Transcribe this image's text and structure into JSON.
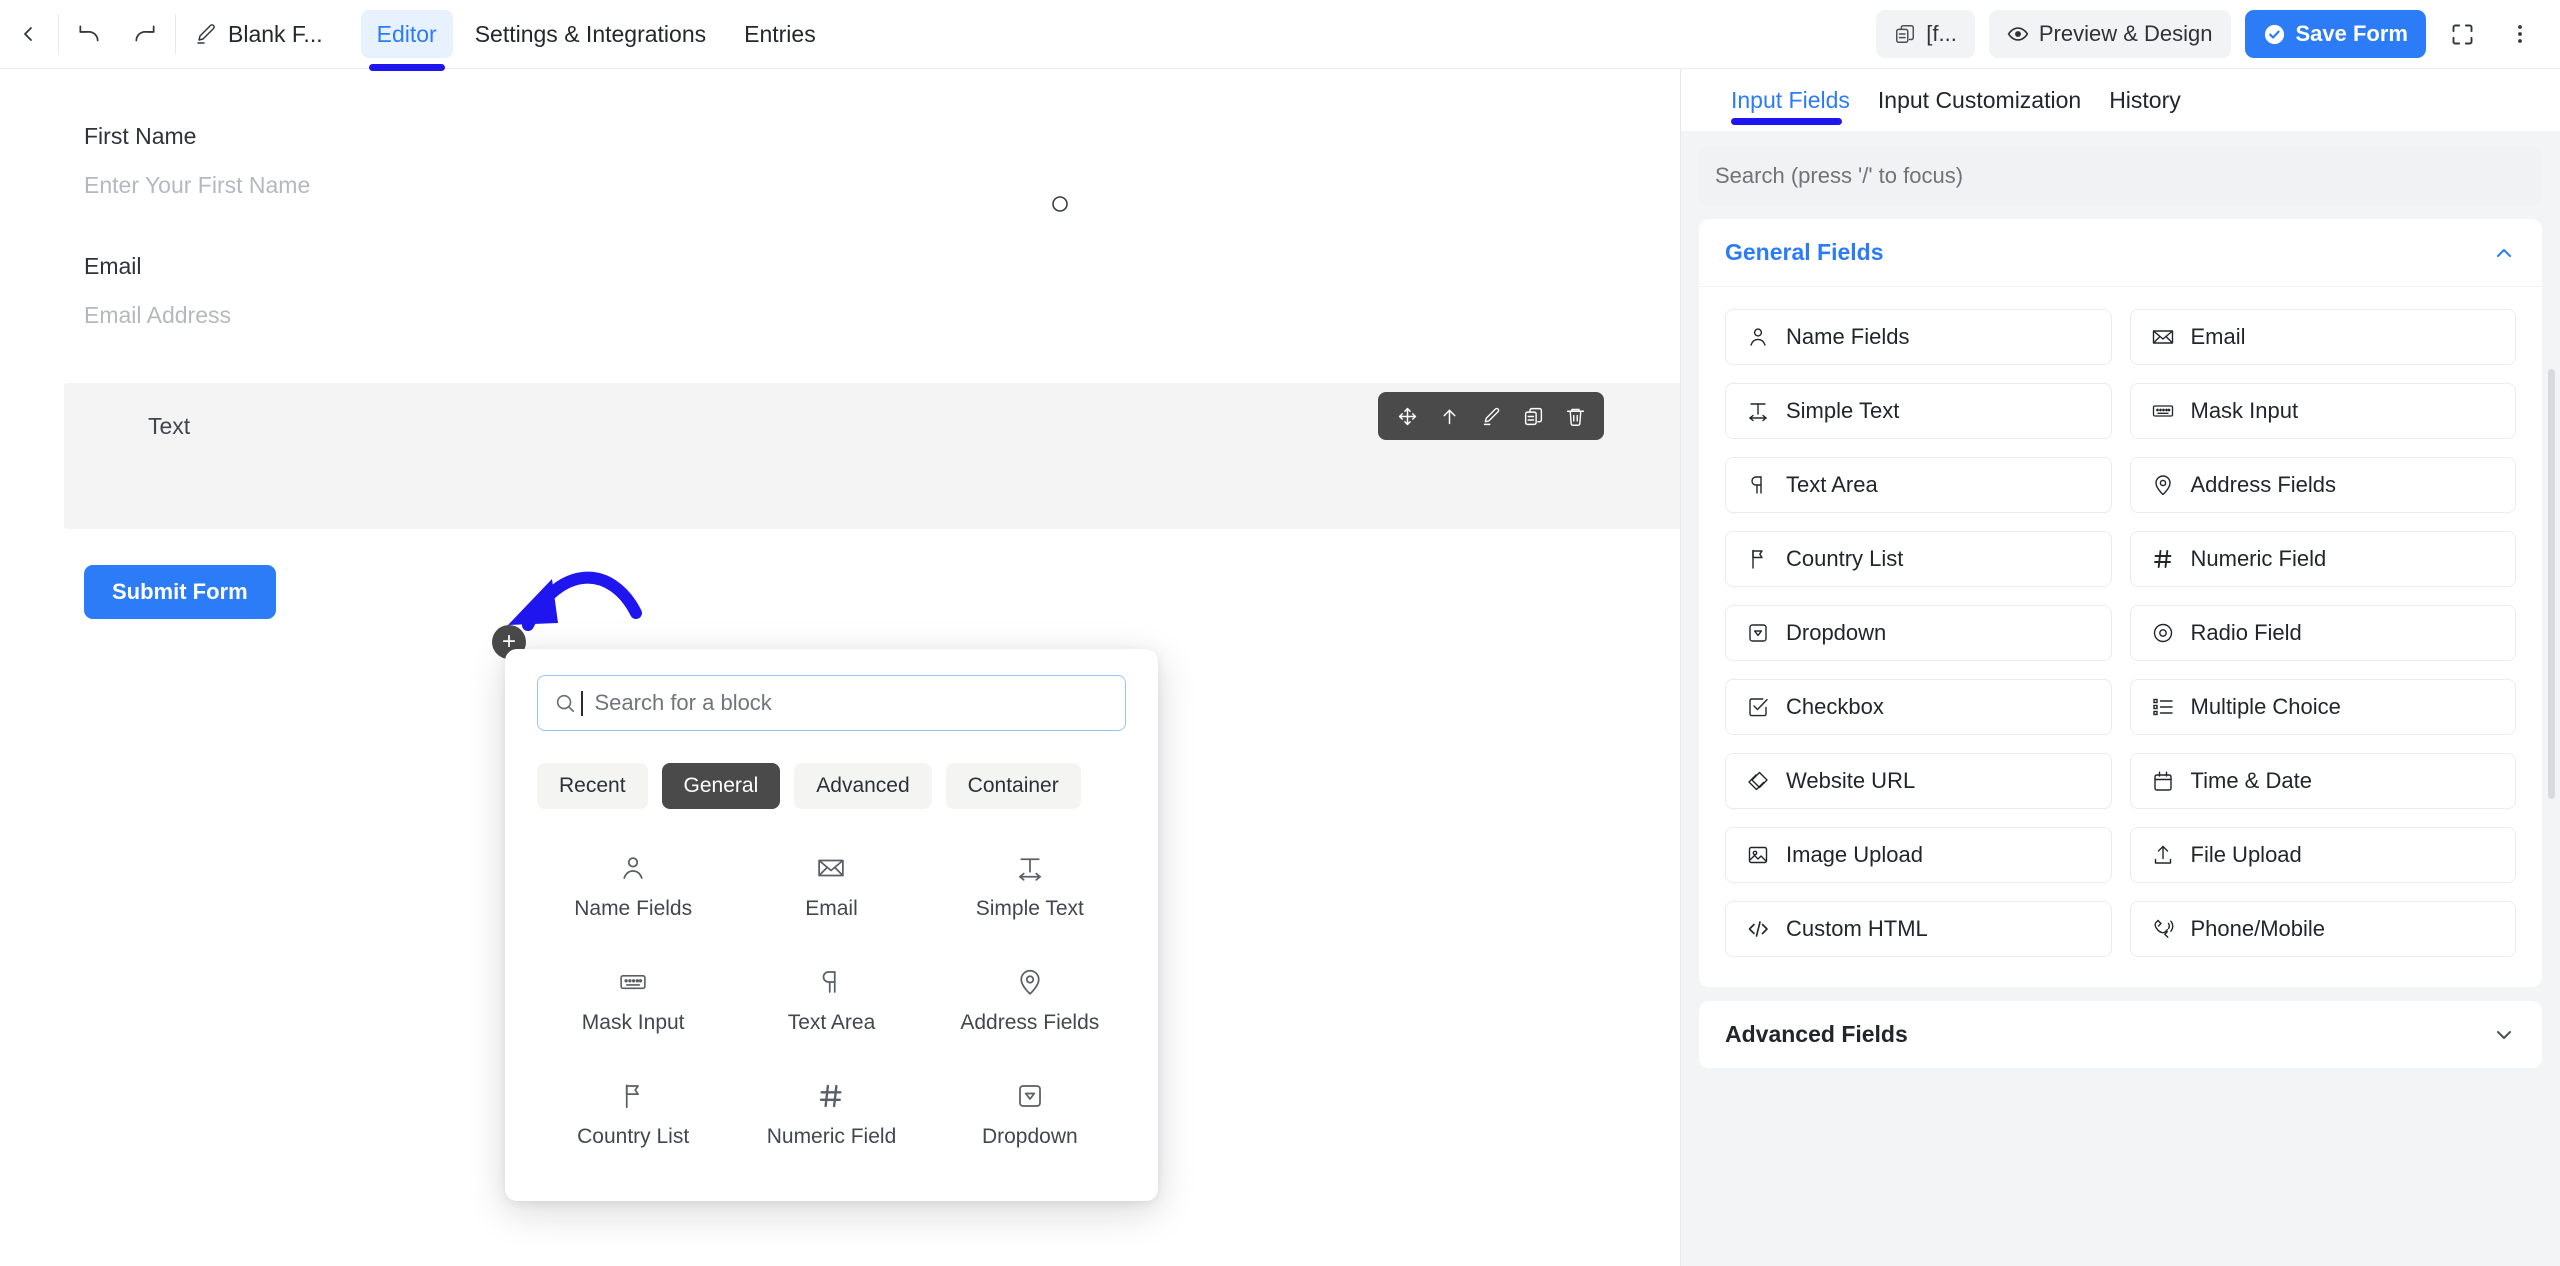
{
  "topbar": {
    "back_label": "Back",
    "undo_label": "Undo",
    "redo_label": "Redo",
    "doc_title": "Blank F...",
    "tabs": [
      {
        "label": "Editor",
        "active": true
      },
      {
        "label": "Settings & Integrations",
        "active": false
      },
      {
        "label": "Entries",
        "active": false
      }
    ],
    "form_code_label": "[f...",
    "preview_label": "Preview & Design",
    "save_label": "Save Form",
    "fullscreen_label": "Fullscreen",
    "more_label": "More options"
  },
  "canvas": {
    "fields": [
      {
        "label": "First Name",
        "placeholder": "Enter Your First Name"
      },
      {
        "label": "Email",
        "placeholder": "Email Address"
      }
    ],
    "selected_block": {
      "label": "Text",
      "toolbar": [
        "move-icon",
        "move-up-icon",
        "edit-icon",
        "duplicate-icon",
        "delete-icon"
      ]
    },
    "add_block_label": "+",
    "submit_label": "Submit Form"
  },
  "picker": {
    "search_placeholder": "Search for a block",
    "search_value": "",
    "chips": [
      {
        "label": "Recent",
        "active": false
      },
      {
        "label": "General",
        "active": true
      },
      {
        "label": "Advanced",
        "active": false
      },
      {
        "label": "Container",
        "active": false
      }
    ],
    "blocks": [
      {
        "label": "Name Fields",
        "icon": "person-icon"
      },
      {
        "label": "Email",
        "icon": "envelope-icon"
      },
      {
        "label": "Simple Text",
        "icon": "text-width-icon"
      },
      {
        "label": "Mask Input",
        "icon": "keyboard-icon"
      },
      {
        "label": "Text Area",
        "icon": "paragraph-icon"
      },
      {
        "label": "Address Fields",
        "icon": "map-pin-icon"
      },
      {
        "label": "Country List",
        "icon": "flag-icon"
      },
      {
        "label": "Numeric Field",
        "icon": "hash-icon"
      },
      {
        "label": "Dropdown",
        "icon": "dropdown-icon"
      }
    ]
  },
  "right_panel": {
    "tabs": [
      {
        "label": "Input Fields",
        "active": true
      },
      {
        "label": "Input Customization",
        "active": false
      },
      {
        "label": "History",
        "active": false
      }
    ],
    "search_placeholder": "Search (press '/' to focus)",
    "search_value": "",
    "sections": [
      {
        "title": "General Fields",
        "expanded": true,
        "fields": [
          {
            "label": "Name Fields",
            "icon": "person-icon"
          },
          {
            "label": "Email",
            "icon": "envelope-icon"
          },
          {
            "label": "Simple Text",
            "icon": "text-width-icon"
          },
          {
            "label": "Mask Input",
            "icon": "keyboard-icon"
          },
          {
            "label": "Text Area",
            "icon": "paragraph-icon"
          },
          {
            "label": "Address Fields",
            "icon": "map-pin-icon"
          },
          {
            "label": "Country List",
            "icon": "flag-icon"
          },
          {
            "label": "Numeric Field",
            "icon": "hash-icon"
          },
          {
            "label": "Dropdown",
            "icon": "dropdown-icon"
          },
          {
            "label": "Radio Field",
            "icon": "radio-icon"
          },
          {
            "label": "Checkbox",
            "icon": "checkbox-icon"
          },
          {
            "label": "Multiple Choice",
            "icon": "list-icon"
          },
          {
            "label": "Website URL",
            "icon": "link-icon"
          },
          {
            "label": "Time & Date",
            "icon": "calendar-icon"
          },
          {
            "label": "Image Upload",
            "icon": "image-icon"
          },
          {
            "label": "File Upload",
            "icon": "upload-icon"
          },
          {
            "label": "Custom HTML",
            "icon": "code-icon"
          },
          {
            "label": "Phone/Mobile",
            "icon": "phone-icon"
          }
        ]
      },
      {
        "title": "Advanced Fields",
        "expanded": false,
        "fields": []
      }
    ]
  },
  "colors": {
    "accent_blue": "#2b7cf6",
    "tab_underline": "#1f16ef",
    "annotation_arrow": "#1f16ef",
    "toolbar_dark": "#4a4a4a",
    "panel_bg": "#f3f4f6",
    "selected_block_bg": "#f4f4f5"
  }
}
